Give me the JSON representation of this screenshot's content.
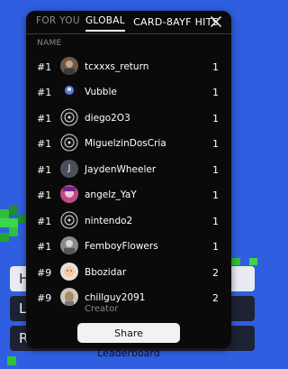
{
  "tabs": {
    "for_you": "FOR YOU",
    "global": "GLOBAL",
    "active": "GLOBAL"
  },
  "columns": {
    "name": "NAME",
    "hits": "CARD-8AYF HITS"
  },
  "rows": [
    {
      "rank": "#1",
      "name": "tcxxxs_return",
      "hits": "1",
      "avatar": "photo-avatar"
    },
    {
      "rank": "#1",
      "name": "Vubble",
      "hits": "1",
      "avatar": "character-avatar"
    },
    {
      "rank": "#1",
      "name": "diego2O3",
      "hits": "1",
      "avatar": "emblem-avatar"
    },
    {
      "rank": "#1",
      "name": "MiguelzinDosCria",
      "hits": "1",
      "avatar": "emblem-avatar"
    },
    {
      "rank": "#1",
      "name": "JaydenWheeler",
      "hits": "1",
      "avatar": "initial-avatar",
      "initial": "J"
    },
    {
      "rank": "#1",
      "name": "angelz_YaY",
      "hits": "1",
      "avatar": "anime-avatar"
    },
    {
      "rank": "#1",
      "name": "nintendo2",
      "hits": "1",
      "avatar": "emblem-avatar"
    },
    {
      "rank": "#1",
      "name": "FemboyFlowers",
      "hits": "1",
      "avatar": "photo-avatar"
    },
    {
      "rank": "#9",
      "name": "Bbozidar",
      "hits": "2",
      "avatar": "baby-avatar"
    },
    {
      "rank": "#9",
      "name": "chillguy2091",
      "sub": "Creator",
      "hits": "2",
      "avatar": "chillguy-avatar"
    }
  ],
  "share_button": "Share Leaderboard",
  "background_buttons": [
    "H",
    "L",
    "R"
  ],
  "colors": {
    "background": "#2f5fe0",
    "panel": "#0a0a0a",
    "accent_green": "#2fbf3a"
  }
}
